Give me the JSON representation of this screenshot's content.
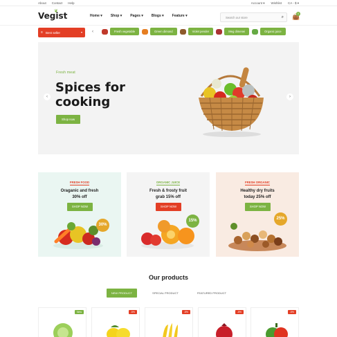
{
  "topbar": {
    "links": [
      "About",
      "Contact",
      "Help"
    ],
    "account": "Account",
    "wishlist": "Wishlist",
    "currency": "CA - $"
  },
  "header": {
    "logo": "Vegist",
    "nav": [
      "Home",
      "Shop",
      "Pages",
      "Blogs",
      "Feature"
    ],
    "search_placeholder": "Search our store",
    "cart_count": "0"
  },
  "categories": {
    "select_label": "Best seller",
    "items": [
      "Fresh vegetable",
      "Green dimond",
      "Violet pender",
      "Meg dimenei",
      "Organic juice"
    ]
  },
  "hero": {
    "small": "Fresh meat",
    "title_line1": "Spices for",
    "title_line2": "cooking",
    "button": "Shop now"
  },
  "promos": [
    {
      "tag": "FRESH FOOD",
      "line1": "Oraganic and fresh",
      "line2": "30% off",
      "button": "SHOP NOW",
      "badge": "30%",
      "bg": "#eaf6f2",
      "accent": "#7cb342",
      "tagcolor": "#e33e25"
    },
    {
      "tag": "ORGANIC JUICE",
      "line1": "Fresh & frosty fruit",
      "line2": "grab 15% off",
      "button": "SHOP NOW",
      "badge": "15%",
      "bg": "#f4f4f4",
      "accent": "#e33e25",
      "tagcolor": "#7cb342"
    },
    {
      "tag": "FRESH ORGANIC",
      "line1": "Healthy dry fruits",
      "line2": "today 25% off",
      "button": "SHOP NOW",
      "badge": "25%",
      "bg": "#f9ebe2",
      "accent": "#7cb342",
      "tagcolor": "#e33e25"
    }
  ],
  "products": {
    "heading": "Our products",
    "tabs": [
      "NEW PRODUCT",
      "SPECIAL PRODUCT",
      "FEATURED PRODUCT"
    ],
    "badges": [
      "New",
      "-5%",
      "-5%",
      "-5%",
      "-5%"
    ]
  },
  "colors": {
    "green": "#7cb342",
    "red": "#e33e25"
  }
}
